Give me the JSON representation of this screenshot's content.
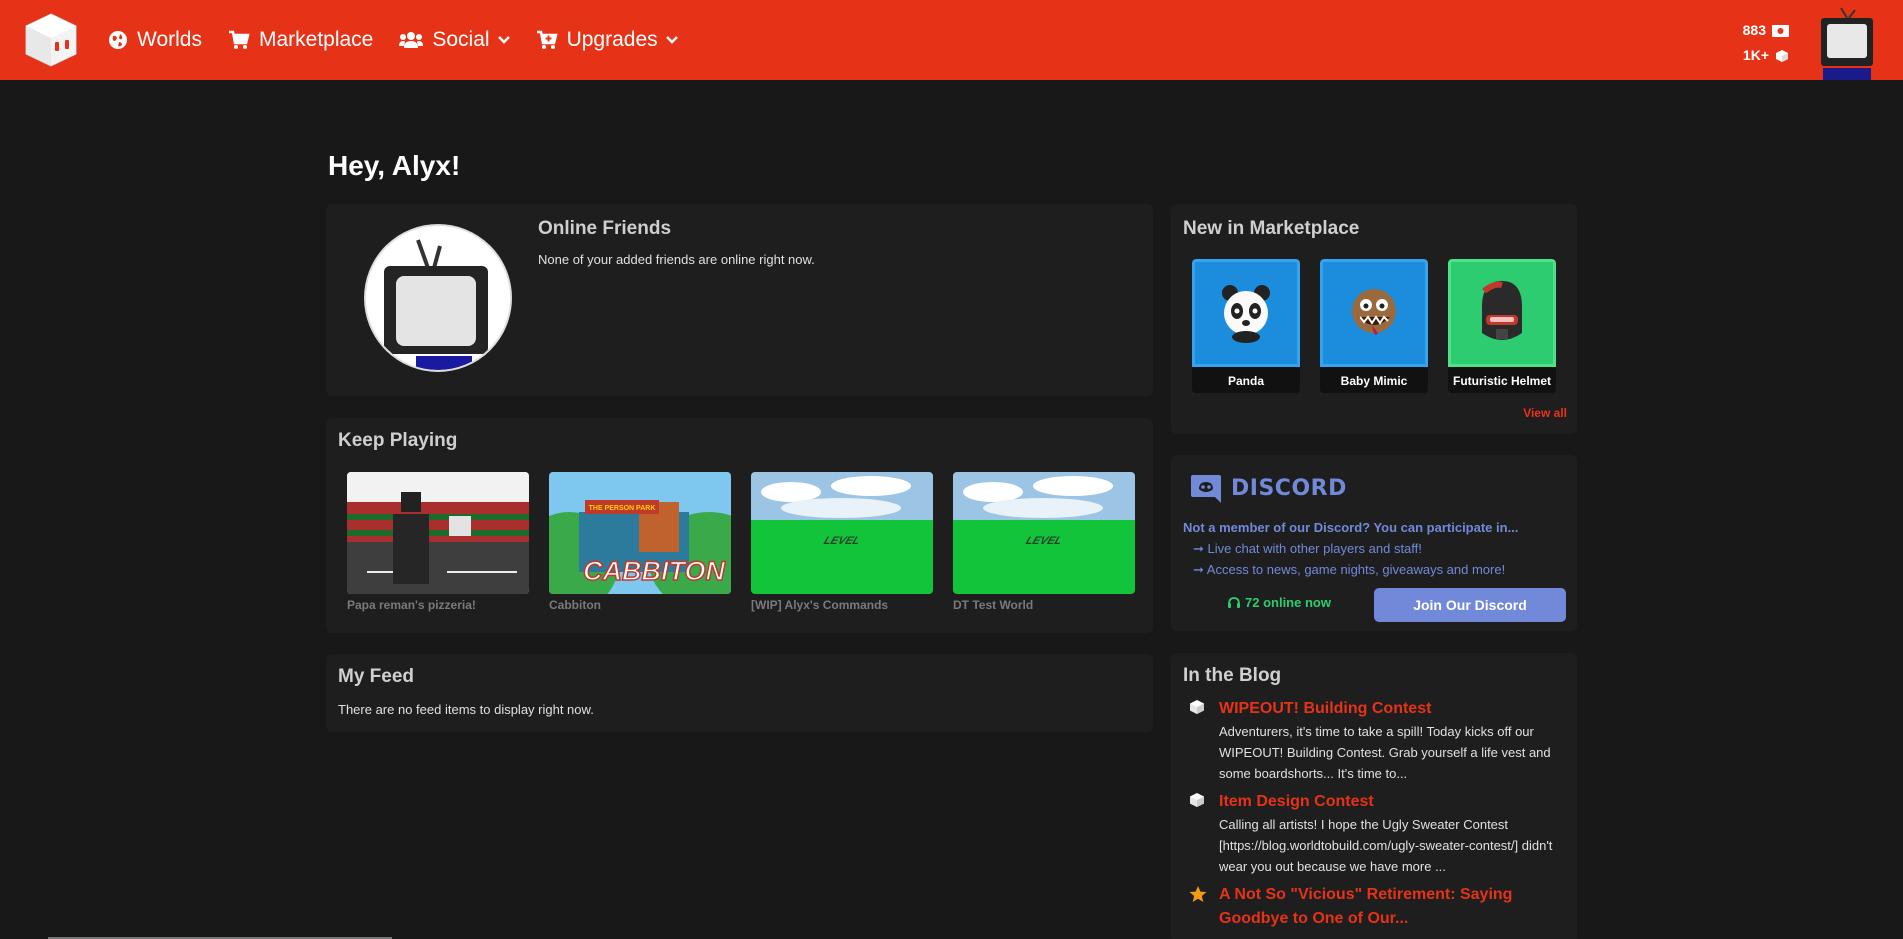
{
  "nav": {
    "worlds": "Worlds",
    "marketplace": "Marketplace",
    "social": "Social",
    "upgrades": "Upgrades",
    "bucks": "883",
    "bits": "1K+"
  },
  "greeting": "Hey, Alyx!",
  "friends": {
    "title": "Online Friends",
    "empty": "None of your added friends are online right now."
  },
  "keep_playing": {
    "title": "Keep Playing",
    "games": [
      {
        "name": "Papa reman's pizzeria!"
      },
      {
        "name": "Cabbiton",
        "thumb_text": "CABBITON",
        "sign_text": "THE PERSON PARK"
      },
      {
        "name": "[WIP] Alyx's Commands",
        "thumb_text": "LEVEL"
      },
      {
        "name": "DT Test World",
        "thumb_text": "LEVEL"
      }
    ]
  },
  "feed": {
    "title": "My Feed",
    "empty": "There are no feed items to display right now."
  },
  "market": {
    "title": "New in Marketplace",
    "items": [
      {
        "name": "Panda",
        "color": "#1b8ddc"
      },
      {
        "name": "Baby Mimic",
        "color": "#1b8ddc"
      },
      {
        "name": "Futuristic Helmet",
        "color": "#2ecc71"
      }
    ],
    "view_all": "View all"
  },
  "discord": {
    "brand": "DISCORD",
    "lead": "Not a member of our Discord? You can participate in...",
    "bullet1": "➞ Live chat with other players and staff!",
    "bullet2": "➞ Access to news, game nights, giveaways and more!",
    "online": "72 online now",
    "join": "Join Our Discord"
  },
  "blog": {
    "title": "In the Blog",
    "posts": [
      {
        "title": "WIPEOUT! Building Contest",
        "excerpt": "Adventurers, it's time to take a spill! Today kicks off our WIPEOUT! Building Contest. Grab yourself a life vest and some boardshorts... It's time to...",
        "icon": "cube-icon"
      },
      {
        "title": "Item Design Contest",
        "excerpt": "Calling all artists! I hope the Ugly Sweater Contest [https://blog.worldtobuild.com/ugly-sweater-contest/] didn't wear you out because we have more ...",
        "icon": "cube-icon"
      },
      {
        "title": "A Not So \"Vicious\" Retirement: Saying Goodbye to One of Our...",
        "excerpt": "",
        "icon": "star-icon"
      }
    ]
  },
  "colors": {
    "brand": "#e63317",
    "discord": "#7289da",
    "online": "#2ecc71",
    "background": "#181818",
    "card": "#1e1e1e"
  }
}
